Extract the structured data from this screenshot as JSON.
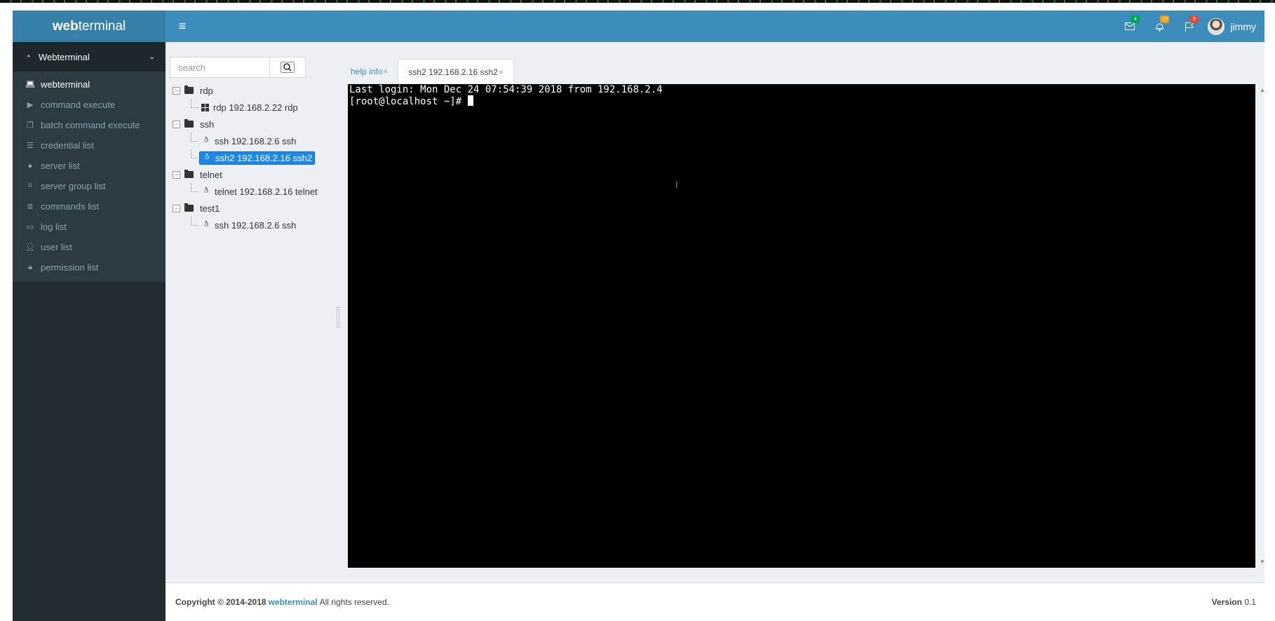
{
  "brand": {
    "bold": "web",
    "rest": "terminal"
  },
  "header": {
    "badges": {
      "mail": "4",
      "notifications": "10",
      "flags": "9"
    },
    "user_name": "jimmy"
  },
  "sidebar": {
    "section": "Webterminal",
    "items": [
      {
        "label": "webterminal",
        "icon": "laptop-icon"
      },
      {
        "label": "command execute",
        "icon": "play-icon"
      },
      {
        "label": "batch command execute",
        "icon": "copy-icon"
      },
      {
        "label": "credential list",
        "icon": "list-ol-icon"
      },
      {
        "label": "server list",
        "icon": "circle-icon"
      },
      {
        "label": "server group list",
        "icon": "crop-icon"
      },
      {
        "label": "commands list",
        "icon": "list-icon"
      },
      {
        "label": "log list",
        "icon": "desktop-icon"
      },
      {
        "label": "user list",
        "icon": "user-icon"
      },
      {
        "label": "permission list",
        "icon": "lock-icon"
      }
    ]
  },
  "search": {
    "placeholder": "search"
  },
  "tree": {
    "groups": [
      {
        "name": "rdp",
        "children": [
          {
            "label": "rdp 192.168.2.22 rdp"
          }
        ]
      },
      {
        "name": "ssh",
        "children": [
          {
            "label": "ssh 192.168.2.6 ssh"
          },
          {
            "label": "ssh2 192.168.2.16 ssh2"
          }
        ]
      },
      {
        "name": "telnet",
        "children": [
          {
            "label": "telnet 192.168.2.16 telnet"
          }
        ]
      },
      {
        "name": "test1",
        "children": [
          {
            "label": "ssh 192.168.2.6 ssh"
          }
        ]
      }
    ]
  },
  "tabs": [
    {
      "label": "help info"
    },
    {
      "label": "ssh2 192.168.2.16 ssh2"
    }
  ],
  "terminal": {
    "line1": "Last login: Mon Dec 24 07:54:39 2018 from 192.168.2.4",
    "line2": "[root@localhost ~]# "
  },
  "footer": {
    "copyright": "Copyright © 2014-2018",
    "link": "webterminal",
    "rights": "All rights reserved.",
    "version_label": "Version",
    "version_value": "0.1"
  }
}
